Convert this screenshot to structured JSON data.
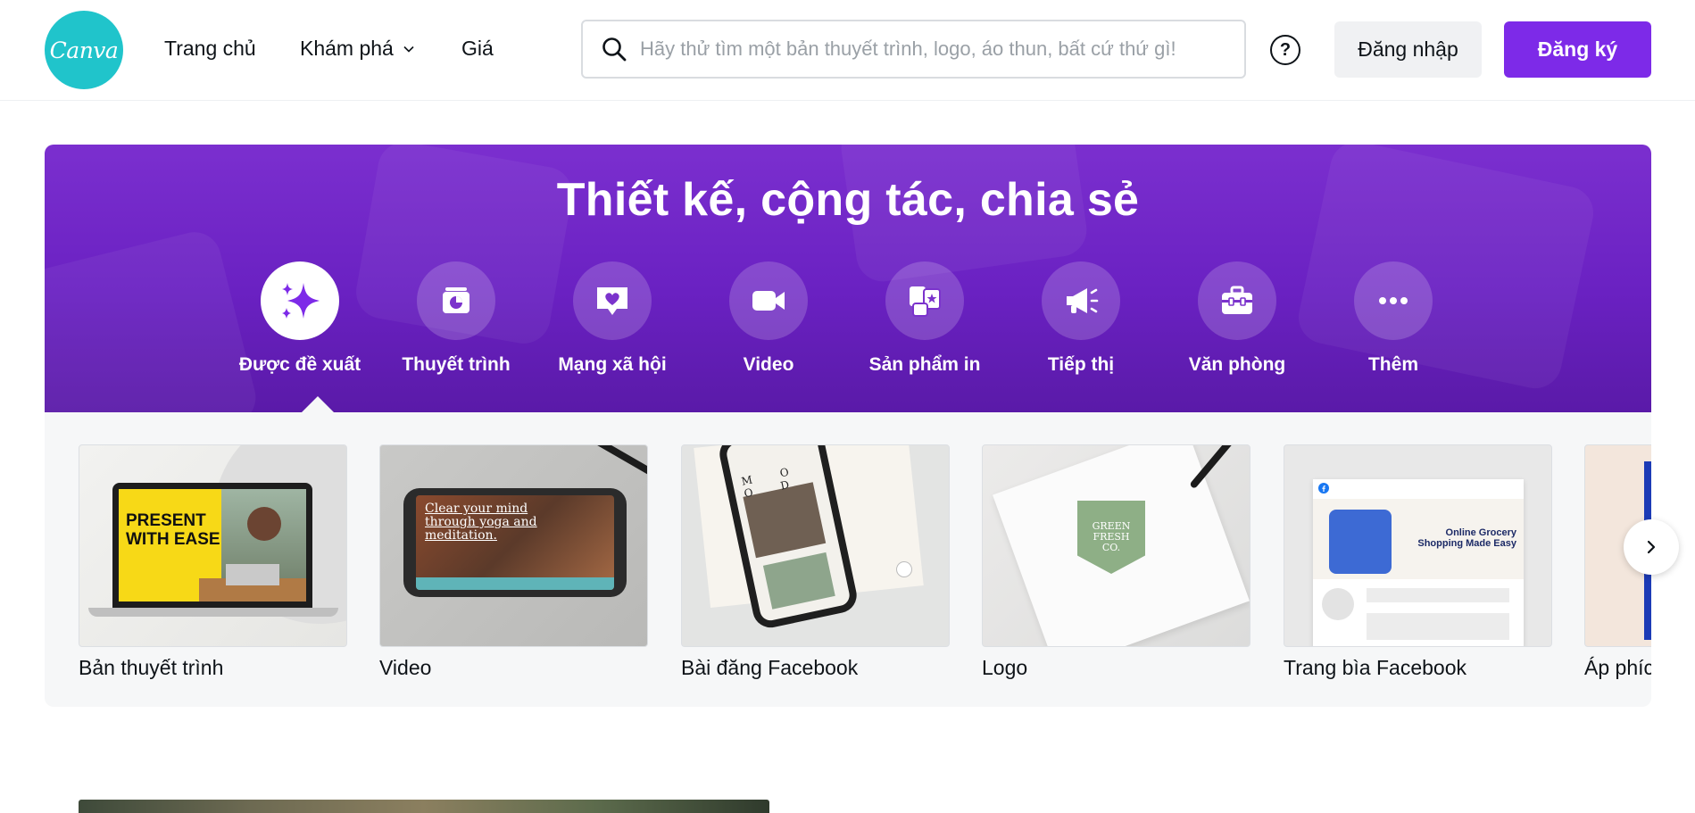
{
  "header": {
    "logo_text": "Canva",
    "nav": {
      "home": "Trang chủ",
      "explore": "Khám phá",
      "pricing": "Giá"
    },
    "search": {
      "placeholder": "Hãy thử tìm một bản thuyết trình, logo, áo thun, bất cứ thứ gì!",
      "value": ""
    },
    "help_icon": "?",
    "login_label": "Đăng nhập",
    "signup_label": "Đăng ký"
  },
  "hero": {
    "title": "Thiết kế, cộng tác, chia sẻ",
    "categories": [
      {
        "label": "Được đề xuất",
        "icon": "sparkles-icon",
        "active": true
      },
      {
        "label": "Thuyết trình",
        "icon": "presentation-icon",
        "active": false
      },
      {
        "label": "Mạng xã hội",
        "icon": "heart-chat-icon",
        "active": false
      },
      {
        "label": "Video",
        "icon": "video-camera-icon",
        "active": false
      },
      {
        "label": "Sản phẩm in",
        "icon": "print-products-icon",
        "active": false
      },
      {
        "label": "Tiếp thị",
        "icon": "megaphone-icon",
        "active": false
      },
      {
        "label": "Văn phòng",
        "icon": "briefcase-icon",
        "active": false
      },
      {
        "label": "Thêm",
        "icon": "more-dots-icon",
        "active": false
      }
    ]
  },
  "carousel": {
    "cards": [
      {
        "label": "Bản thuyết trình",
        "thumb_text": "PRESENT\nWITH EASE"
      },
      {
        "label": "Video",
        "thumb_text": "Clear your mind through yoga and meditation."
      },
      {
        "label": "Bài đăng Facebook",
        "thumb_text": "M O O D"
      },
      {
        "label": "Logo",
        "thumb_text": "GREEN FRESH CO."
      },
      {
        "label": "Trang bìa Facebook",
        "thumb_text": "Online Grocery Shopping Made Easy"
      },
      {
        "label": "Áp phích",
        "thumb_text": ""
      }
    ],
    "next_icon": "chevron-right-icon"
  },
  "colors": {
    "brand_purple": "#7d2ae8",
    "logo_teal": "#20c4cb",
    "hero_purple": "#6a21c2"
  }
}
